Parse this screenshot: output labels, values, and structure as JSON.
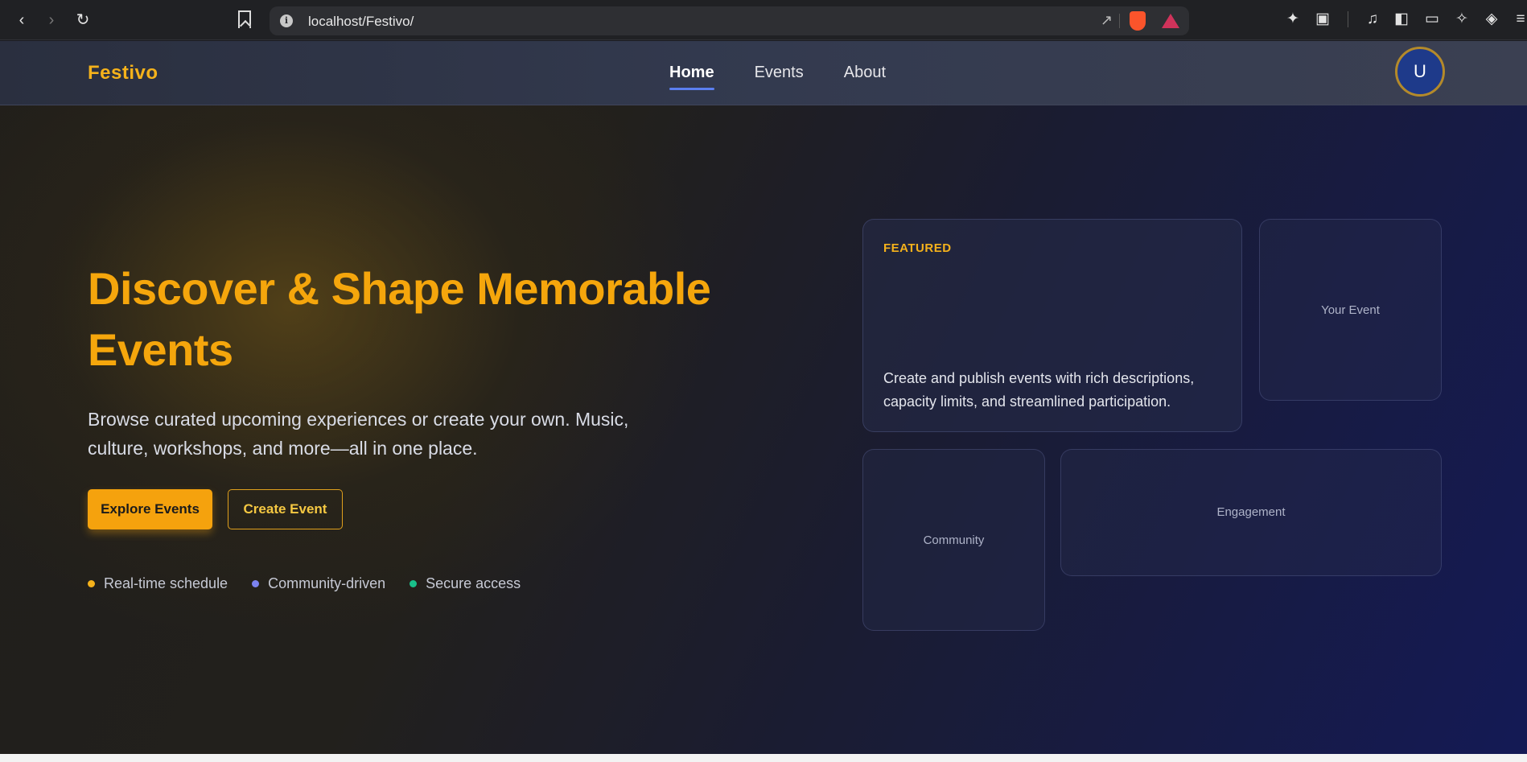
{
  "browser": {
    "url": "localhost/Festivo/",
    "back_icon": "chevron-left-icon",
    "forward_icon": "chevron-right-icon",
    "reload_icon": "reload-icon"
  },
  "nav": {
    "brand": "Festivo",
    "links": [
      "Home",
      "Events",
      "About"
    ],
    "active": "Home",
    "avatar_initial": "U"
  },
  "hero": {
    "title": "Discover & Shape Memorable Events",
    "subtitle": "Browse curated upcoming experiences or create your own. Music, culture, workshops, and more—all in one place.",
    "primary_button": "Explore Events",
    "secondary_button": "Create Event",
    "features": [
      {
        "label": "Real-time schedule",
        "color": "#f5b21b"
      },
      {
        "label": "Community-driven",
        "color": "#7c83f0"
      },
      {
        "label": "Secure access",
        "color": "#19c08a"
      }
    ]
  },
  "cards": {
    "featured_tag": "FEATURED",
    "featured_desc": "Create and publish events with rich descriptions, capacity limits, and streamlined participation.",
    "your_event": "Your Event",
    "community": "Community",
    "engagement": "Engagement"
  },
  "colors": {
    "accent": "#f5a20d",
    "brand": "#f5b21b",
    "nav_underline": "#5b7ff0",
    "avatar_bg": "#1e3a8a"
  }
}
